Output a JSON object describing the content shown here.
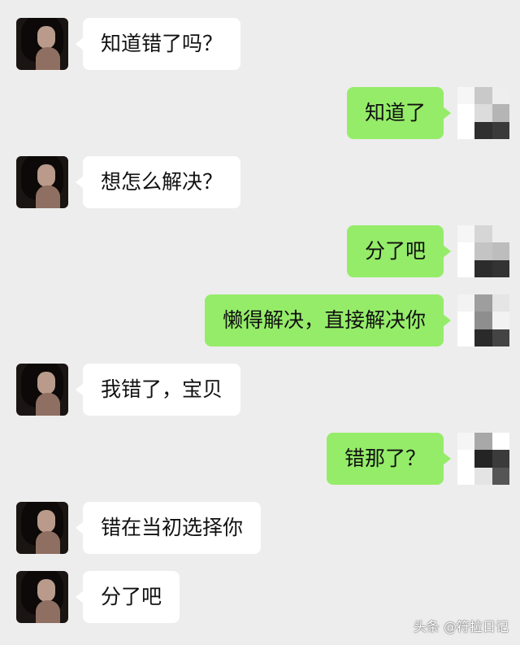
{
  "messages": [
    {
      "side": "in",
      "text": "知道错了吗？"
    },
    {
      "side": "out",
      "text": "知道了"
    },
    {
      "side": "in",
      "text": "想怎么解决？"
    },
    {
      "side": "out",
      "text": "分了吧"
    },
    {
      "side": "out",
      "text": "懒得解决，直接解决你"
    },
    {
      "side": "in",
      "text": "我错了，宝贝"
    },
    {
      "side": "out",
      "text": "错那了？"
    },
    {
      "side": "in",
      "text": "错在当初选择你"
    },
    {
      "side": "in",
      "text": "分了吧"
    }
  ],
  "watermark": "头条 @符拉日记"
}
